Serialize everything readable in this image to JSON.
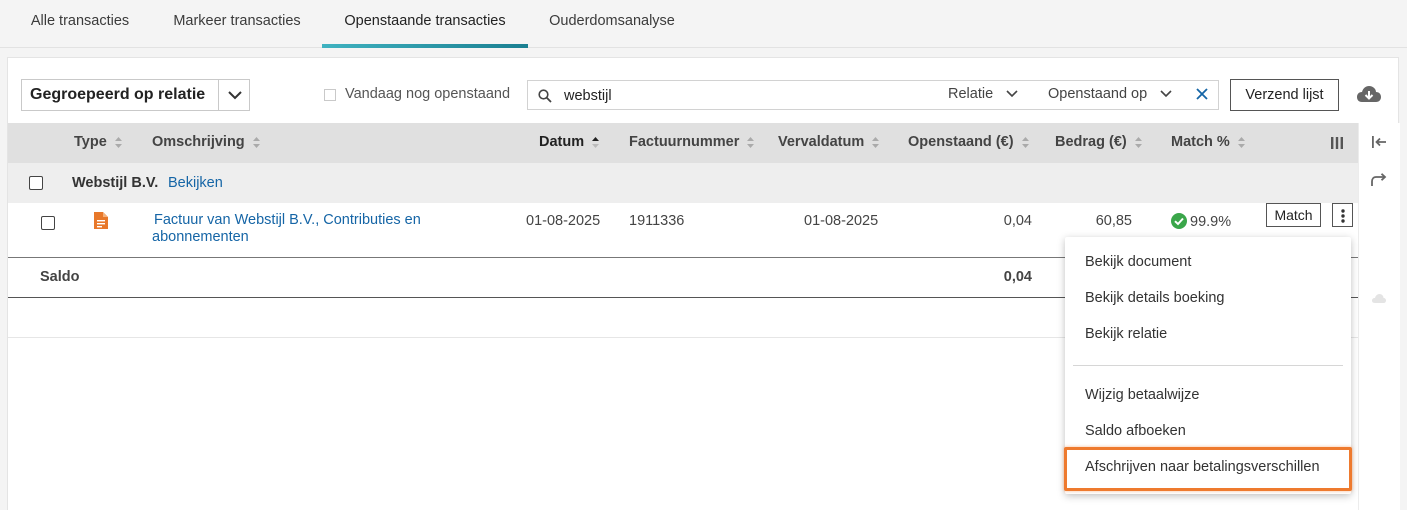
{
  "tabs": [
    {
      "label": "Alle transacties"
    },
    {
      "label": "Markeer transacties"
    },
    {
      "label": "Openstaande transacties",
      "active": true
    },
    {
      "label": "Ouderdomsanalyse"
    }
  ],
  "toolbar": {
    "group_by": "Gegroepeerd op relatie",
    "today_checkbox_label": "Vandaag nog openstaand",
    "search_value": "webstijl",
    "filter_relatie": "Relatie",
    "filter_openstaand": "Openstaand op",
    "send_button": "Verzend lijst"
  },
  "table": {
    "headers": {
      "type": "Type",
      "omschrijving": "Omschrijving",
      "datum": "Datum",
      "factuurnummer": "Factuurnummer",
      "vervaldatum": "Vervaldatum",
      "openstaand": "Openstaand (€)",
      "bedrag": "Bedrag (€)",
      "match": "Match %"
    },
    "group": {
      "name": "Webstijl B.V.",
      "link": "Bekijken"
    },
    "row": {
      "desc_prefix": "Factuur van",
      "desc_relation": "Webstijl B.V.,",
      "desc_line1_rest": "Contributies en",
      "desc_line2": "abonnementen",
      "datum": "01-08-2025",
      "factuurnummer": "1911336",
      "vervaldatum": "01-08-2025",
      "openstaand": "0,04",
      "bedrag": "60,85",
      "match_pct": "99.9%",
      "match_button": "Match"
    },
    "saldo": {
      "label": "Saldo",
      "total_openstaand": "0,04"
    }
  },
  "menu": {
    "items": [
      "Bekijk document",
      "Bekijk details boeking",
      "Bekijk relatie",
      "Wijzig betaalwijze",
      "Saldo afboeken",
      "Afschrijven naar betalingsverschillen"
    ],
    "highlighted_item": "Afschrijven naar betalingsverschillen"
  },
  "colors": {
    "accent": "#1a7f91",
    "link": "#1565a6",
    "highlight": "#ee7a2e",
    "match_ok": "#3aa64a",
    "doc_icon": "#e8782a"
  }
}
